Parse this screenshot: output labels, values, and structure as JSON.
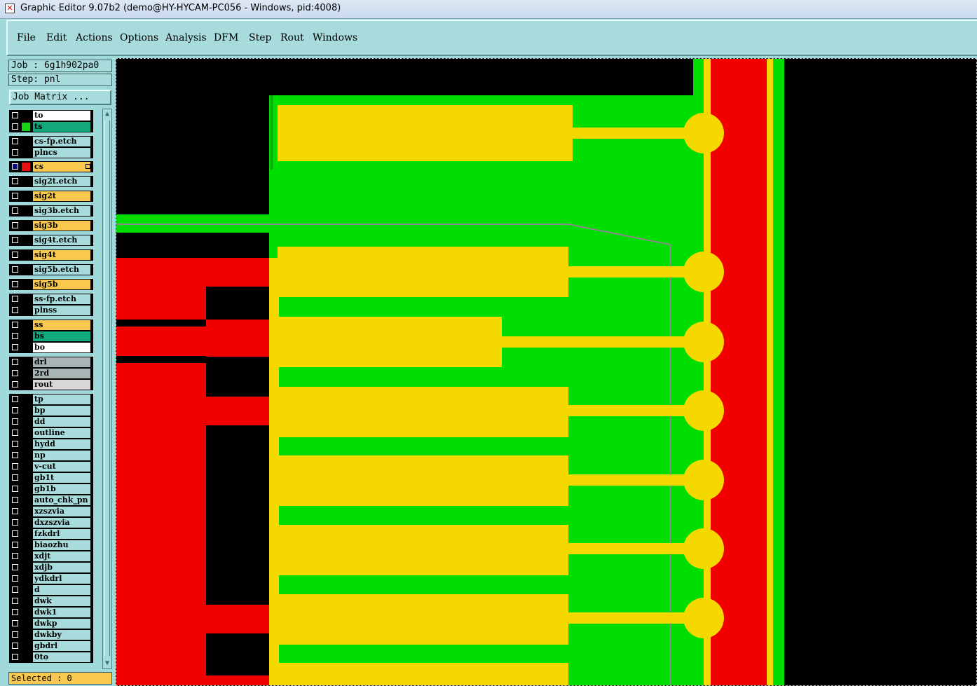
{
  "window": {
    "title": "Graphic Editor 9.07b2 (demo@HY-HYCAM-PC056 - Windows, pid:4008)"
  },
  "menu": [
    "File",
    "Edit",
    "Actions",
    "Options",
    "Analysis",
    "DFM",
    "Step",
    "Rout",
    "Windows"
  ],
  "panel": {
    "job": "Job : 6g1h902pa0",
    "step": "Step: pnl",
    "job_matrix_button": "Job Matrix ...",
    "selected": "Selected : 0"
  },
  "layers": [
    {
      "name": "to",
      "bg": "#ffffff"
    },
    {
      "name": "ts",
      "bg": "#12a87a",
      "swatch": "#19d419"
    },
    {
      "name": "cs-fp.etch",
      "bg": "#a8dcdc"
    },
    {
      "name": "plncs",
      "bg": "#a8dcdc"
    },
    {
      "name": "cs",
      "bg": "#f9c84e",
      "swatch": "#e81010",
      "active": true
    },
    {
      "name": "sig2t.etch",
      "bg": "#a8dcdc"
    },
    {
      "name": "sig2t",
      "bg": "#f9c84e"
    },
    {
      "name": "sig3b.etch",
      "bg": "#a8dcdc"
    },
    {
      "name": "sig3b",
      "bg": "#f9c84e"
    },
    {
      "name": "sig4t.etch",
      "bg": "#a8dcdc"
    },
    {
      "name": "sig4t",
      "bg": "#f9c84e"
    },
    {
      "name": "sig5b.etch",
      "bg": "#a8dcdc"
    },
    {
      "name": "sig5b",
      "bg": "#f9c84e"
    },
    {
      "name": "ss-fp.etch",
      "bg": "#a8dcdc"
    },
    {
      "name": "plnss",
      "bg": "#a8dcdc"
    },
    {
      "name": "ss",
      "bg": "#f9c84e"
    },
    {
      "name": "bs",
      "bg": "#12a87a"
    },
    {
      "name": "bo",
      "bg": "#ffffff"
    },
    {
      "name": "drl",
      "bg": "#a9b5b5"
    },
    {
      "name": "2rd",
      "bg": "#a9b5b5"
    },
    {
      "name": "rout",
      "bg": "#d8d8d8"
    },
    {
      "name": "tp",
      "bg": "#a8dcdc"
    },
    {
      "name": "bp",
      "bg": "#a8dcdc"
    },
    {
      "name": "dd",
      "bg": "#a8dcdc"
    },
    {
      "name": "outline",
      "bg": "#a8dcdc"
    },
    {
      "name": "hydd",
      "bg": "#a8dcdc"
    },
    {
      "name": "np",
      "bg": "#a8dcdc"
    },
    {
      "name": "v-cut",
      "bg": "#a8dcdc"
    },
    {
      "name": "gb1t",
      "bg": "#a8dcdc"
    },
    {
      "name": "gb1b",
      "bg": "#a8dcdc"
    },
    {
      "name": "auto_chk_pn",
      "bg": "#a8dcdc"
    },
    {
      "name": "xzszvia",
      "bg": "#a8dcdc"
    },
    {
      "name": "dxzszvia",
      "bg": "#a8dcdc"
    },
    {
      "name": "fzkdrl",
      "bg": "#a8dcdc"
    },
    {
      "name": "biaozhu",
      "bg": "#a8dcdc"
    },
    {
      "name": "xdjt",
      "bg": "#a8dcdc"
    },
    {
      "name": "xdjb",
      "bg": "#a8dcdc"
    },
    {
      "name": "ydkdrl",
      "bg": "#a8dcdc"
    },
    {
      "name": "d",
      "bg": "#a8dcdc"
    },
    {
      "name": "dwk",
      "bg": "#a8dcdc"
    },
    {
      "name": "dwk1",
      "bg": "#a8dcdc"
    },
    {
      "name": "dwkp",
      "bg": "#a8dcdc"
    },
    {
      "name": "dwkby",
      "bg": "#a8dcdc"
    },
    {
      "name": "gbdrl",
      "bg": "#a8dcdc"
    },
    {
      "name": "0to",
      "bg": "#a8dcdc"
    }
  ],
  "colors": {
    "canvas_bg": "#000000",
    "copper_green": "#00dd00",
    "pad_yellow": "#f5d800",
    "cs_red": "#f20000",
    "panel_bg": "#9fd9d9"
  },
  "icons": {
    "title": "app-icon",
    "scroll_up": "arrow-up-icon",
    "scroll_down": "arrow-down-icon"
  }
}
